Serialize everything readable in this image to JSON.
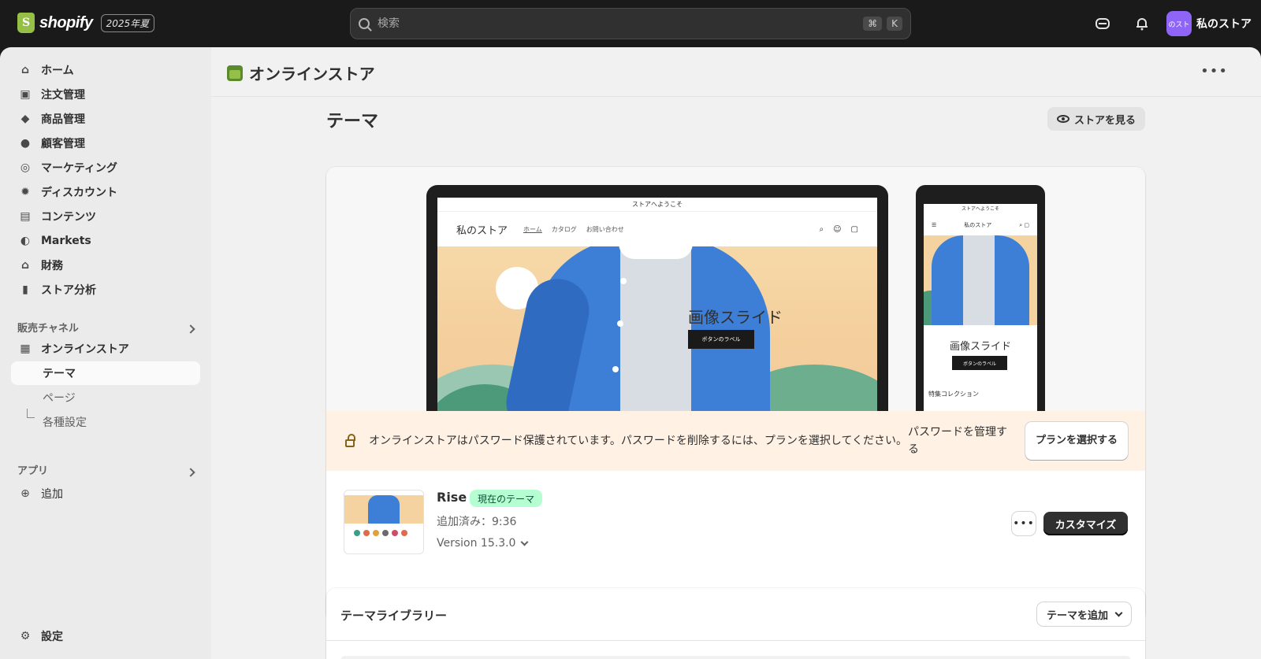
{
  "topbar": {
    "logo_text": "shopify",
    "logo_letter": "S",
    "edition_badge": "2025年夏",
    "search_placeholder": "検索",
    "shortcut_cmd": "⌘",
    "shortcut_key": "K",
    "avatar_text": "のスト",
    "store_name": "私のストア"
  },
  "sidebar": {
    "items": [
      {
        "label": "ホーム",
        "icon": "home-icon"
      },
      {
        "label": "注文管理",
        "icon": "inbox-icon"
      },
      {
        "label": "商品管理",
        "icon": "tag-icon"
      },
      {
        "label": "顧客管理",
        "icon": "person-icon"
      },
      {
        "label": "マーケティング",
        "icon": "target-icon"
      },
      {
        "label": "ディスカウント",
        "icon": "discount-icon"
      },
      {
        "label": "コンテンツ",
        "icon": "content-icon"
      },
      {
        "label": "Markets",
        "icon": "globe-icon"
      },
      {
        "label": "財務",
        "icon": "bank-icon"
      },
      {
        "label": "ストア分析",
        "icon": "chart-icon"
      }
    ],
    "sales_channels_label": "販売チャネル",
    "online_store": "オンラインストア",
    "sub_items": [
      "テーマ",
      "ページ",
      "各種設定"
    ],
    "apps_label": "アプリ",
    "add_label": "追加",
    "settings_label": "設定"
  },
  "main": {
    "header_title": "オンラインストア",
    "page_title": "テーマ",
    "view_store_label": "ストアを見る",
    "preview": {
      "announcement": "ストアへようこそ",
      "brand": "私のストア",
      "nav_links": [
        "ホーム",
        "カタログ",
        "お問い合わせ"
      ],
      "hero_title": "画像スライド",
      "hero_button": "ボタンのラベル",
      "featured_collection": "特集コレクション"
    },
    "password_banner": {
      "message": "オンラインストアはパスワード保護されています。パスワードを削除するには、プランを選択してください。",
      "manage_link": "パスワードを管理する",
      "plan_button": "プランを選択する"
    },
    "theme": {
      "name": "Rise",
      "badge": "現在のテーマ",
      "added": "追加済み：9:36",
      "version": "Version 15.3.0",
      "customize_label": "カスタマイズ"
    },
    "library": {
      "title": "テーマライブラリー",
      "add_theme_label": "テーマを追加"
    }
  },
  "colors": {
    "topbar_bg": "#1a1a1a",
    "sidebar_bg": "#ebebeb",
    "main_bg": "#f1f1f1",
    "badge_bg": "#b4fed2",
    "banner_bg": "#fff1e3",
    "avatar_bg": "#8e65f7"
  }
}
